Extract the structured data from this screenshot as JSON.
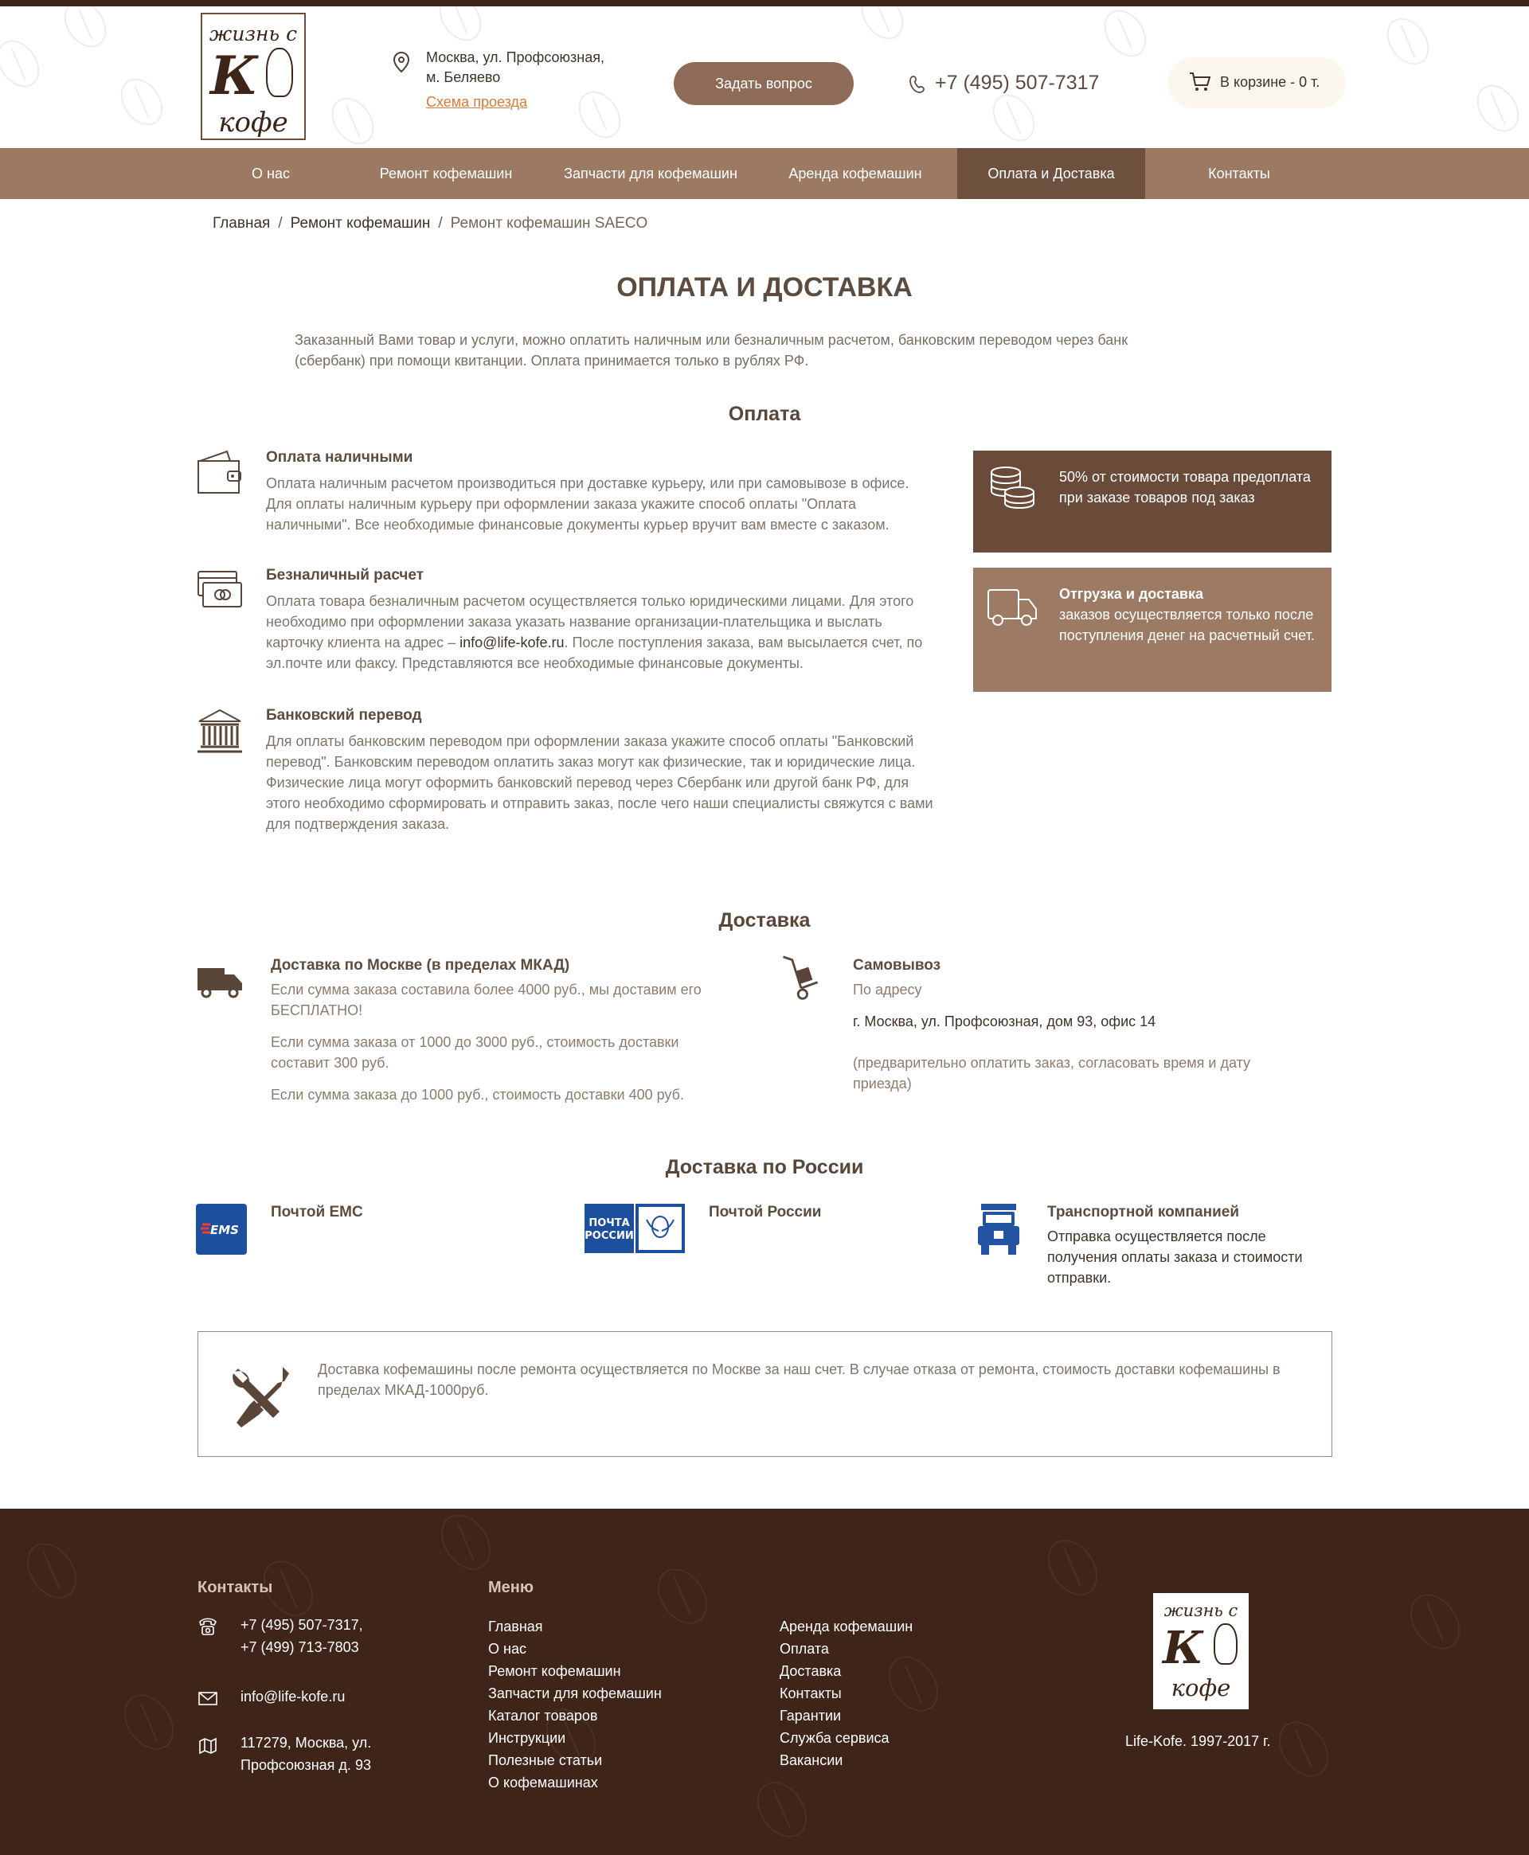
{
  "header": {
    "logo_text": {
      "top": "жизнь с",
      "letter": "К",
      "bottom": "кофе"
    },
    "address_lines": [
      "Москва, ул. Профсоюзная,",
      "м. Беляево"
    ],
    "map_link": "Схема проезда",
    "ask_button": "Задать вопрос",
    "phone": "+7 (495) 507-7317",
    "cart": "В корзине - 0 т."
  },
  "nav": {
    "items": [
      {
        "label": "О нас",
        "active": false
      },
      {
        "label": "Ремонт кофемашин",
        "active": false
      },
      {
        "label": "Запчасти для кофемашин",
        "active": false
      },
      {
        "label": "Аренда кофемашин",
        "active": false
      },
      {
        "label": "Оплата и Доставка",
        "active": true
      },
      {
        "label": "Контакты",
        "active": false
      }
    ]
  },
  "breadcrumbs": [
    "Главная",
    "Ремонт кофемашин",
    "Ремонт кофемашин SAECO"
  ],
  "page": {
    "title": "ОПЛАТА И ДОСТАВКА",
    "intro": "Заказанный Вами товар и услуги, можно оплатить наличным или безналичным расчетом, банковским переводом через банк (сбербанк) при помощи квитанции. Оплата принимается только в рублях РФ."
  },
  "payment": {
    "title": "Оплата",
    "items": [
      {
        "title": "Оплата наличными",
        "text": "Оплата наличным расчетом производиться при доставке курьеру, или при самовывозе в офисе. Для оплаты наличным курьеру при оформлении заказа укажите способ оплаты \"Оплата наличными\". Все необходимые финансовые документы курьер вручит вам вместе с заказом."
      },
      {
        "title": "Безналичный расчет",
        "text_before": "Оплата товара безналичным расчетом осуществляется только юридическими лицами. Для этого необходимо при оформлении заказа указать название организации-плательщика и выслать карточку клиента на адрес – ",
        "email": "info@life-kofe.ru",
        "text_after": ". После поступления заказа, вам высылается счет, по эл.почте или факсу. Представляются все необходимые финансовые документы."
      },
      {
        "title": "Банковский перевод",
        "text": "Для оплаты банковским переводом при оформлении заказа укажите способ оплаты \"Банковский перевод\". Банковским переводом оплатить заказ могут как физические, так и юридические лица. Физические лица могут оформить банковский перевод через Сбербанк или другой банк РФ, для этого необходимо сформировать и отправить заказ, после чего наши специалисты свяжутся с вами для подтверждения заказа."
      }
    ],
    "side_boxes": [
      {
        "title": "",
        "text": "50% от стоимости товара предоплата при заказе товаров под заказ",
        "color": "#6a4b39"
      },
      {
        "title": "Отгрузка и доставка",
        "text": "заказов осуществляется только после поступления денег на расчетный счет.",
        "color": "#9c7a63"
      }
    ]
  },
  "delivery": {
    "title": "Доставка",
    "moscow": {
      "title": "Доставка по Москве (в пределах МКАД)",
      "lines": [
        "Если сумма заказа составила более 4000 руб., мы доставим его БЕСПЛАТНО!",
        "Если сумма заказа от 1000 до 3000 руб., стоимость доставки составит 300 руб.",
        "Если сумма заказа до 1000 руб., стоимость доставки 400 руб."
      ]
    },
    "pickup": {
      "title": "Самовывоз",
      "subtitle": "По адресу",
      "address": "г. Москва, ул. Профсоюзная, дом 93, офис 14",
      "note": "(предварительно оплатить заказ, согласовать время и дату приезда)"
    }
  },
  "russia": {
    "title": "Доставка по России",
    "ems_logo": "EMS",
    "post_logo_lines": [
      "ПОЧТА",
      "РОССИИ"
    ],
    "items": [
      {
        "title": "Почтой EMC",
        "text": ""
      },
      {
        "title": "Почтой России",
        "text": ""
      },
      {
        "title": "Транспортной компанией",
        "text": "Отправка осуществляется после получения оплаты заказа и стоимости отправки."
      }
    ]
  },
  "notice": {
    "text": "Доставка кофемашины после ремонта осуществляется по Москве за наш счет. В случае отказа от ремонта, стоимость доставки кофемашины в пределах МКАД-1000руб."
  },
  "footer": {
    "contacts_title": "Контакты",
    "phones": [
      "+7 (495) 507-7317,",
      "+7 (499) 713-7803"
    ],
    "email": "info@life-kofe.ru",
    "address_lines": [
      "117279, Москва, ул.",
      "Профсоюзная д. 93"
    ],
    "menu_title": "Меню",
    "menu_col1": [
      "Главная",
      "О нас",
      "Ремонт кофемашин",
      "Запчасти для кофемашин",
      "Каталог товаров",
      "Инструкции",
      "Полезные статьи",
      "О кофемашинах"
    ],
    "menu_col2": [
      "Аренда кофемашин",
      "Оплата",
      "Доставка",
      "Контакты",
      "Гарантии",
      "Служба сервиса",
      "Вакансии"
    ],
    "logo_text": {
      "top": "жизнь с",
      "letter": "К",
      "bottom": "кофе"
    },
    "copyright": "Life-Kofe. 1997-2017 г."
  },
  "colors": {
    "brown_dark": "#3f2419",
    "brown_nav": "#9b7962",
    "brown_active": "#6e503f",
    "link_orange": "#d77b3b",
    "ems_blue": "#1d4f9f",
    "truck_blue": "#2453a2"
  },
  "icons": {
    "address": "location-pin-icon",
    "phone": "phone-icon",
    "cart": "cart-icon",
    "cash": "wallet-icon",
    "cashless": "card-icon",
    "bank": "bank-icon",
    "coins": "coins-icon",
    "shipping": "delivery-truck-icon",
    "moscow_delivery": "truck-icon",
    "pickup": "hand-truck-icon",
    "transport_company": "lorry-icon",
    "repair": "tools-icon",
    "footer_phone": "phone-icon",
    "footer_email": "mail-icon",
    "footer_address": "map-icon"
  }
}
